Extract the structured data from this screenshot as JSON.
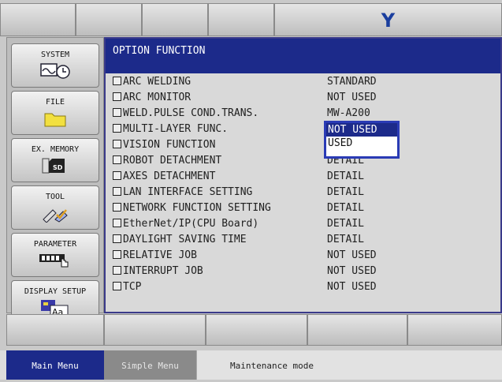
{
  "header": {
    "logo_text": "Y"
  },
  "sidebar": {
    "items": [
      {
        "label": "SYSTEM",
        "icon": "system-icon"
      },
      {
        "label": "FILE",
        "icon": "folder-icon"
      },
      {
        "label": "EX. MEMORY",
        "icon": "sd-card-icon"
      },
      {
        "label": "TOOL",
        "icon": "tool-icon"
      },
      {
        "label": "PARAMETER",
        "icon": "parameter-icon"
      },
      {
        "label": "DISPLAY SETUP",
        "icon": "display-setup-icon"
      }
    ]
  },
  "panel": {
    "title": "OPTION FUNCTION",
    "rows": [
      {
        "name": "ARC WELDING",
        "value": "STANDARD"
      },
      {
        "name": "ARC MONITOR",
        "value": "NOT USED"
      },
      {
        "name": "WELD.PULSE COND.TRANS.",
        "value": "MW-A200"
      },
      {
        "name": "MULTI-LAYER FUNC.",
        "value": ""
      },
      {
        "name": "VISION FUNCTION",
        "value": ""
      },
      {
        "name": "ROBOT DETACHMENT",
        "value": "DETAIL"
      },
      {
        "name": "AXES DETACHMENT",
        "value": "DETAIL"
      },
      {
        "name": "LAN INTERFACE SETTING",
        "value": "DETAIL"
      },
      {
        "name": "NETWORK FUNCTION SETTING",
        "value": "DETAIL"
      },
      {
        "name": "EtherNet/IP(CPU Board)",
        "value": "DETAIL"
      },
      {
        "name": "DAYLIGHT SAVING TIME",
        "value": "DETAIL"
      },
      {
        "name": "RELATIVE JOB",
        "value": "NOT USED"
      },
      {
        "name": "INTERRUPT JOB",
        "value": "NOT USED"
      },
      {
        "name": "TCP",
        "value": "NOT USED"
      }
    ],
    "dropdown": {
      "options": [
        "NOT USED",
        "USED"
      ],
      "selected": "NOT USED"
    }
  },
  "footer": {
    "main_menu": "Main Menu",
    "simple_menu": "Simple Menu",
    "status": "Maintenance mode"
  },
  "colors": {
    "title_bar": "#1c2a8a",
    "dropdown_border": "#2a3bb5",
    "main_menu_bg": "#1c2a8a"
  }
}
